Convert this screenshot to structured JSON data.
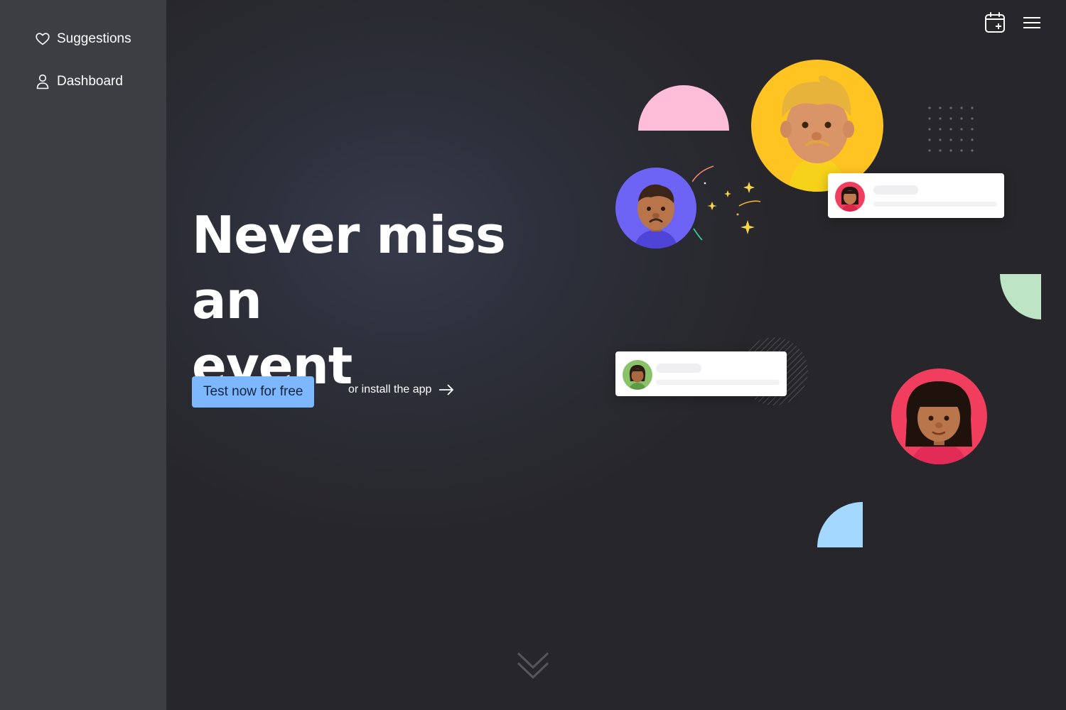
{
  "sidebar": {
    "items": [
      {
        "label": "Suggestions",
        "icon": "heart-icon"
      },
      {
        "label": "Dashboard",
        "icon": "user-icon"
      }
    ]
  },
  "header": {
    "icons": [
      "calendar-add-icon",
      "menu-icon"
    ]
  },
  "hero": {
    "headline_line1": "Never miss an",
    "headline_line2": "event",
    "cta_label": "Test now for free",
    "install_label": "or install the app"
  },
  "colors": {
    "sidebar": "#3d3e44",
    "background": "#27272b",
    "cta": "#7db7ff",
    "pink": "#ffbed8",
    "yellow": "#ffc422",
    "purple": "#6d63f5",
    "red": "#f23e5e",
    "green": "#bde4c4",
    "blue": "#a4d8ff"
  }
}
